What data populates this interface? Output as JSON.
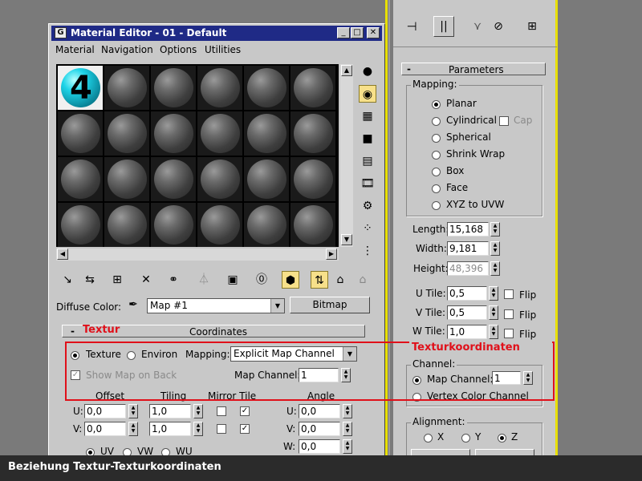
{
  "window": {
    "title": "Material Editor - 01 - Default",
    "app_icon": "G",
    "btn_minimize": "_",
    "btn_restore": "□",
    "btn_close": "✕"
  },
  "menu": [
    "Material",
    "Navigation",
    "Options",
    "Utilities"
  ],
  "sample_slot_label": "4",
  "diffuse": {
    "label": "Diffuse Color:",
    "map_name": "Map #1",
    "type_button": "Bitmap"
  },
  "coordinates": {
    "rollout_title": "Coordinates",
    "collapse": "-",
    "texture_label": "Texture",
    "environ_label": "Environ",
    "mapping_label": "Mapping:",
    "mapping_value": "Explicit Map Channel",
    "show_map_label": "Show Map on Back",
    "map_channel_label": "Map Channel:",
    "map_channel_value": "1",
    "col_offset": "Offset",
    "col_tiling": "Tiling",
    "col_mirror": "Mirror Tile",
    "col_angle": "Angle",
    "u_label": "U:",
    "v_label": "V:",
    "w_label": "W:",
    "u_offset": "0,0",
    "v_offset": "0,0",
    "u_tiling": "1,0",
    "v_tiling": "1,0",
    "u_angle": "0,0",
    "v_angle": "0,0",
    "w_angle": "0,0",
    "uv_label": "UV",
    "vw_label": "VW",
    "wu_label": "WU"
  },
  "parameters": {
    "rollout_title": "Parameters",
    "collapse": "-",
    "mapping_group": "Mapping:",
    "options": [
      "Planar",
      "Cylindrical",
      "Spherical",
      "Shrink Wrap",
      "Box",
      "Face",
      "XYZ to UVW"
    ],
    "cap_label": "Cap",
    "length_label": "Length:",
    "length_value": "15,168",
    "width_label": "Width:",
    "width_value": "9,181",
    "height_label": "Height:",
    "height_value": "48,396",
    "utile_label": "U Tile:",
    "utile_value": "0,5",
    "vtile_label": "V Tile:",
    "vtile_value": "0,5",
    "wtile_label": "W Tile:",
    "wtile_value": "1,0",
    "flip_label": "Flip",
    "channel_group": "Channel:",
    "map_channel_label": "Map Channel:",
    "map_channel_value": "1",
    "vertex_color_label": "Vertex Color Channel",
    "alignment_group": "Alignment:",
    "align_x": "X",
    "align_y": "Y",
    "align_z": "Z"
  },
  "annotations": {
    "textur": "Textur",
    "texturkoordinaten": "Texturkoordinaten",
    "highlight_color": "#e0101a"
  },
  "caption": "Beziehung Textur-Texturkoordinaten"
}
